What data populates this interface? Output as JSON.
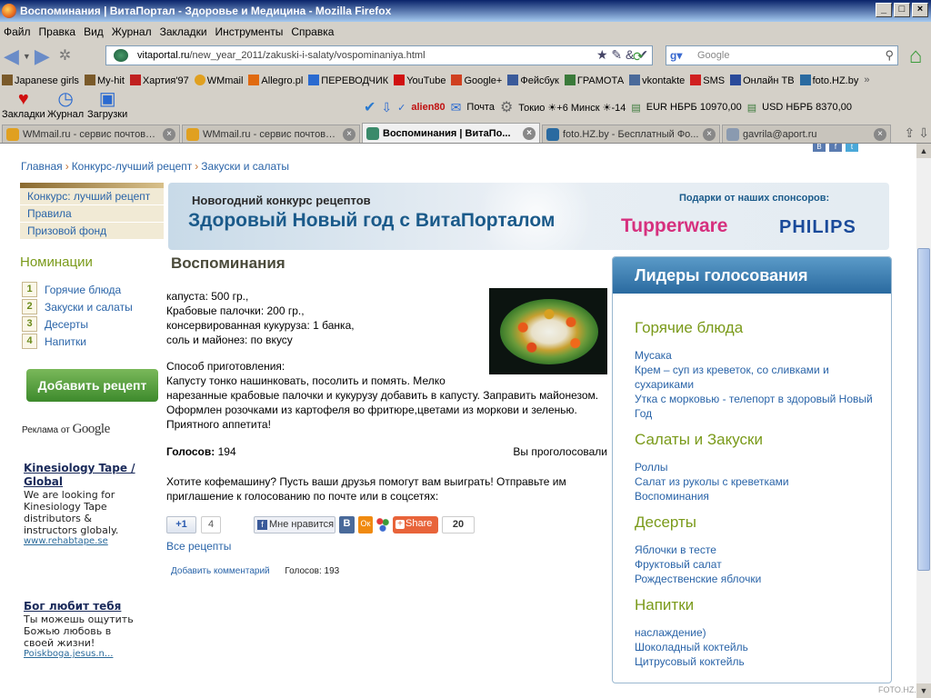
{
  "window": {
    "title": "Воспоминания | ВитаПортал - Здоровье и Медицина - Mozilla Firefox"
  },
  "menu": [
    "Файл",
    "Правка",
    "Вид",
    "Журнал",
    "Закладки",
    "Инструменты",
    "Справка"
  ],
  "url": {
    "host": "vitaportal.ru",
    "path": "/new_year_2011/zakuski-i-salaty/vospominaniya.html"
  },
  "search": {
    "placeholder": "Google"
  },
  "bookmarks": [
    {
      "label": "Japanese girls",
      "color": "#7a5a2a"
    },
    {
      "label": "My-hit",
      "color": "#7a5a2a"
    },
    {
      "label": "Хартия'97",
      "color": "#c02020"
    },
    {
      "label": "WMmail",
      "color": "#e0a020"
    },
    {
      "label": "Allegro.pl",
      "color": "#e06a10"
    },
    {
      "label": "ПЕРЕВОДЧИК",
      "color": "#2a6ad0"
    },
    {
      "label": "YouTube",
      "color": "#d01010"
    },
    {
      "label": "Google+",
      "color": "#d04020"
    },
    {
      "label": "Фейсбук",
      "color": "#3a5a9a"
    },
    {
      "label": "ГРАМОТА",
      "color": "#3a7a3a"
    },
    {
      "label": "vkontakte",
      "color": "#4a6a9a"
    },
    {
      "label": "SMS",
      "color": "#d02020"
    },
    {
      "label": "Онлайн ТВ",
      "color": "#2a4a9a"
    },
    {
      "label": "foto.HZ.by",
      "color": "#2a6aa0"
    }
  ],
  "toolbar3": {
    "bookmarks": "Закладки",
    "journal": "Журнал",
    "downloads": "Загрузки",
    "user": "alien80",
    "mail": "Почта",
    "weather1": "Токио ☀+6 Минск ☀-14",
    "eur": "EUR НБРБ 10970,00",
    "usd": "USD НБРБ 8370,00"
  },
  "tabs": [
    {
      "label": "WMmail.ru - сервис почтовых ...",
      "active": false,
      "color": "#e0a020"
    },
    {
      "label": "WMmail.ru - сервис почтовых ...",
      "active": false,
      "color": "#e0a020"
    },
    {
      "label": "Воспоминания | ВитаПо...",
      "active": true,
      "color": "#3a8a6a"
    },
    {
      "label": "foto.HZ.by - Бесплатный Фо...",
      "active": false,
      "color": "#2a6aa0"
    },
    {
      "label": "gavrila@aport.ru",
      "active": false,
      "color": "#8a9ab0"
    }
  ],
  "breadcrumb": [
    "Главная",
    "Конкурс-лучший рецепт",
    "Закуски и салаты"
  ],
  "left_menu": [
    "Конкурс: лучший рецепт",
    "Правила",
    "Призовой фонд"
  ],
  "nominations": {
    "title": "Номинации",
    "items": [
      {
        "num": "1",
        "label": "Горячие блюда"
      },
      {
        "num": "2",
        "label": "Закуски и салаты"
      },
      {
        "num": "3",
        "label": "Десерты"
      },
      {
        "num": "4",
        "label": "Напитки"
      }
    ]
  },
  "add_recipe": "Добавить рецепт",
  "ads": {
    "label": "Реклама от",
    "google": "Google",
    "items": [
      {
        "title": "Kinesiology Tape / Global",
        "body": "We are looking for Kinesiology Tape distributors & instructors globaly.",
        "url": "www.rehabtape.se"
      },
      {
        "title": "Бог любит тебя",
        "body": "Ты можешь ощутить Божью любовь в своей жизни!",
        "url": "Poiskboga.jesus.n..."
      }
    ]
  },
  "banner": {
    "small": "Новогодний конкурс рецептов",
    "big": "Здоровый Новый год с ВитаПорталом",
    "sponsors": "Подарки от наших спонсоров:",
    "tupperware": "Tupperware",
    "philips": "PHILIPS"
  },
  "recipe": {
    "title": "Воспоминания",
    "ingredients": [
      "капуста: 500 гр.,",
      "Крабовые палочки: 200 гр.,",
      "консервированная кукуруза: 1 банка,",
      "соль и майонез: по вкусу"
    ],
    "method_title": "Способ приготовления:",
    "method": "Капусту тонко нашинковать, посолить и помять. Мелко нарезанные крабовые палочки и кукурузу добавить в капусту. Заправить майонезом. Оформлен розочками из картофеля во фритюре,цветами из моркови и зеленью. Приятного аппетита!",
    "votes_label": "Голосов:",
    "votes": "194",
    "voted": "Вы проголосовали",
    "invite": "Хотите кофемашину? Пусть ваши друзья помогут вам выиграть! Отправьте им приглашение к голосованию по почте или в соцсетях:",
    "plus_one": "+1",
    "plus_count": "4",
    "fb_like": "Мне нравится",
    "vk": "В",
    "ok": "Ок",
    "share": "Share",
    "share_count": "20",
    "all_recipes": "Все рецепты",
    "add_comment": "Добавить комментарий",
    "votes_small": "Голосов: 193"
  },
  "leaders": {
    "title": "Лидеры голосования",
    "sections": [
      {
        "name": "Горячие блюда",
        "items": [
          "Мусака",
          "Крем – суп из креветок, со сливками и сухариками",
          "Утка с морковью - телепорт в здоровый Новый Год"
        ]
      },
      {
        "name": "Салаты и Закуски",
        "items": [
          "Роллы",
          "Салат из руколы с креветками",
          "Воспоминания"
        ]
      },
      {
        "name": "Десерты",
        "items": [
          "Яблочки в тесте",
          "Фруктовый салат",
          "Рождественские яблочки"
        ]
      },
      {
        "name": "Напитки",
        "items": [
          "наслаждение)",
          "Шоколадный коктейль",
          "Цитрусовый коктейль"
        ]
      }
    ]
  },
  "watermark": "FOTO.HZ.BY"
}
